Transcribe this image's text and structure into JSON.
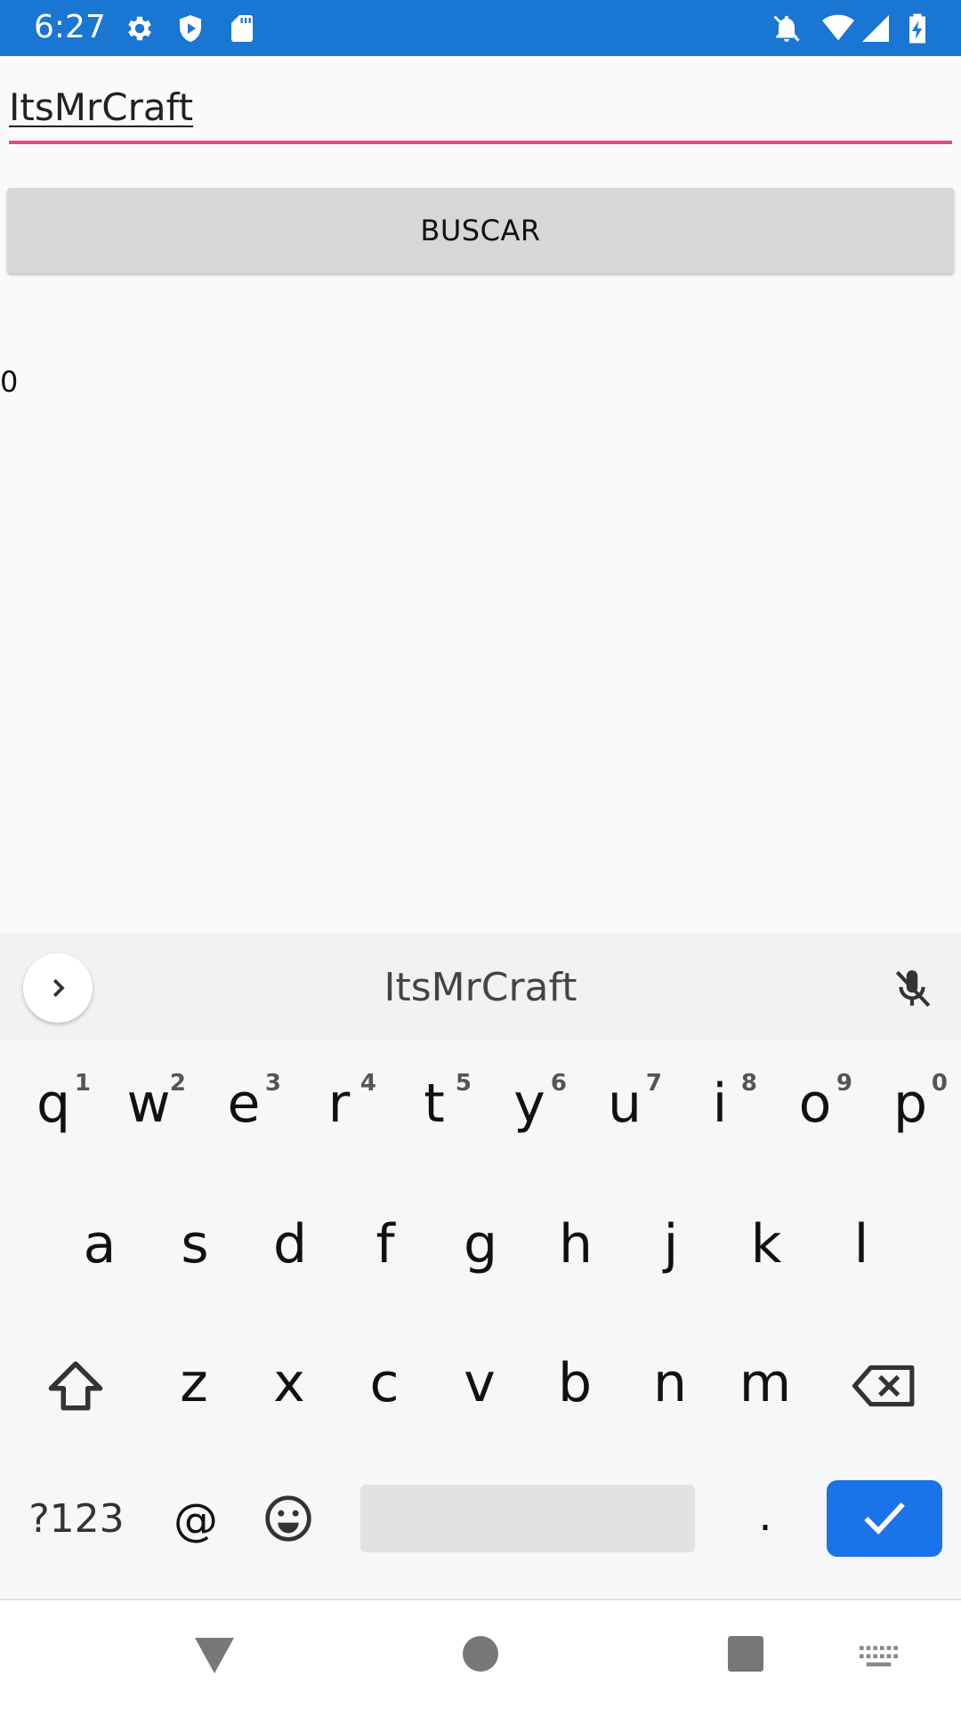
{
  "status_bar": {
    "time": "6:27",
    "background": "#1976d2",
    "left_icons": [
      "gear-icon",
      "shield-icon",
      "sd-card-icon"
    ],
    "right_icons": [
      "notifications-off-icon",
      "wifi-icon",
      "cell-signal-icon",
      "battery-charging-icon"
    ]
  },
  "search": {
    "value": "ItsMrCraft",
    "underline_color": "#e64980"
  },
  "buscar_button": {
    "label": "BUSCAR"
  },
  "result": {
    "count": "0"
  },
  "keyboard": {
    "suggestion": "ItsMrCraft",
    "row1": [
      {
        "key": "q",
        "hint": "1"
      },
      {
        "key": "w",
        "hint": "2"
      },
      {
        "key": "e",
        "hint": "3"
      },
      {
        "key": "r",
        "hint": "4"
      },
      {
        "key": "t",
        "hint": "5"
      },
      {
        "key": "y",
        "hint": "6"
      },
      {
        "key": "u",
        "hint": "7"
      },
      {
        "key": "i",
        "hint": "8"
      },
      {
        "key": "o",
        "hint": "9"
      },
      {
        "key": "p",
        "hint": "0"
      }
    ],
    "row2": [
      "a",
      "s",
      "d",
      "f",
      "g",
      "h",
      "j",
      "k",
      "l"
    ],
    "row3": [
      "z",
      "x",
      "c",
      "v",
      "b",
      "n",
      "m"
    ],
    "symbols_label": "?123",
    "at_label": "@",
    "period_label": ".",
    "enter_color": "#1a73e8"
  },
  "nav_bar": {
    "icons": [
      "back-icon",
      "home-icon",
      "recents-icon",
      "keyboard-switch-icon"
    ]
  }
}
